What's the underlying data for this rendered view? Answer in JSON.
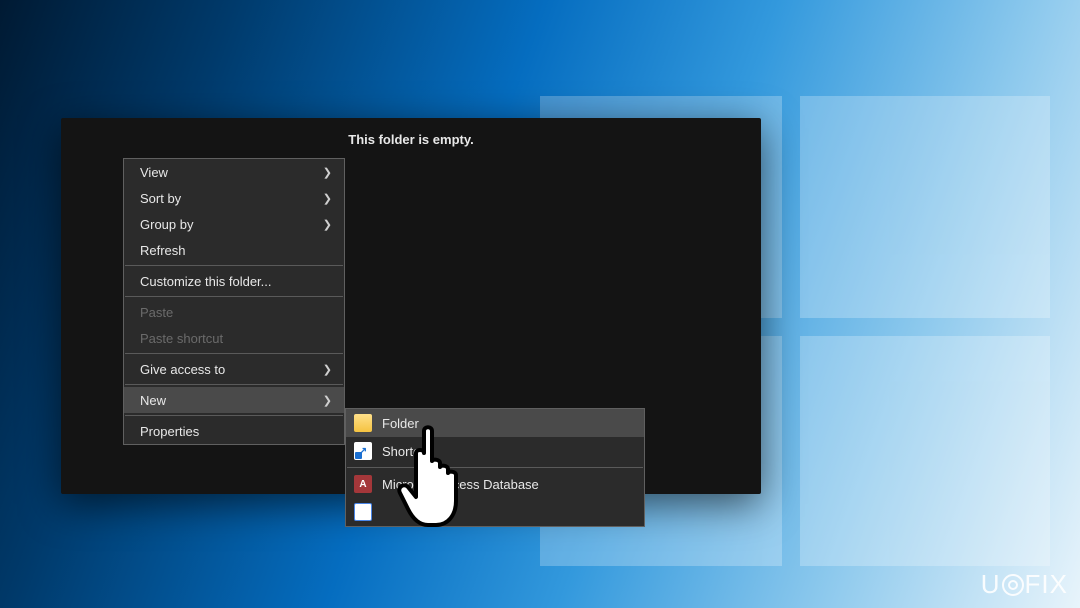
{
  "explorer": {
    "empty_text": "This folder is empty."
  },
  "context_menu": {
    "items": [
      {
        "label": "View",
        "has_submenu": true
      },
      {
        "label": "Sort by",
        "has_submenu": true
      },
      {
        "label": "Group by",
        "has_submenu": true
      },
      {
        "label": "Refresh"
      },
      {
        "sep": true
      },
      {
        "label": "Customize this folder..."
      },
      {
        "sep": true
      },
      {
        "label": "Paste",
        "disabled": true
      },
      {
        "label": "Paste shortcut",
        "disabled": true
      },
      {
        "sep": true
      },
      {
        "label": "Give access to",
        "has_submenu": true
      },
      {
        "sep": true
      },
      {
        "label": "New",
        "has_submenu": true,
        "highlight": true
      },
      {
        "sep": true
      },
      {
        "label": "Properties"
      }
    ]
  },
  "new_submenu": {
    "items": [
      {
        "icon": "folder",
        "label": "Folder",
        "highlight": true
      },
      {
        "icon": "shortcut",
        "label": "Shortcut"
      },
      {
        "sep": true
      },
      {
        "icon": "access",
        "label": "Microsoft Access Database"
      },
      {
        "icon": "doc",
        "label": ""
      }
    ]
  },
  "watermark": {
    "text_left": "U",
    "text_right": "FIX"
  }
}
